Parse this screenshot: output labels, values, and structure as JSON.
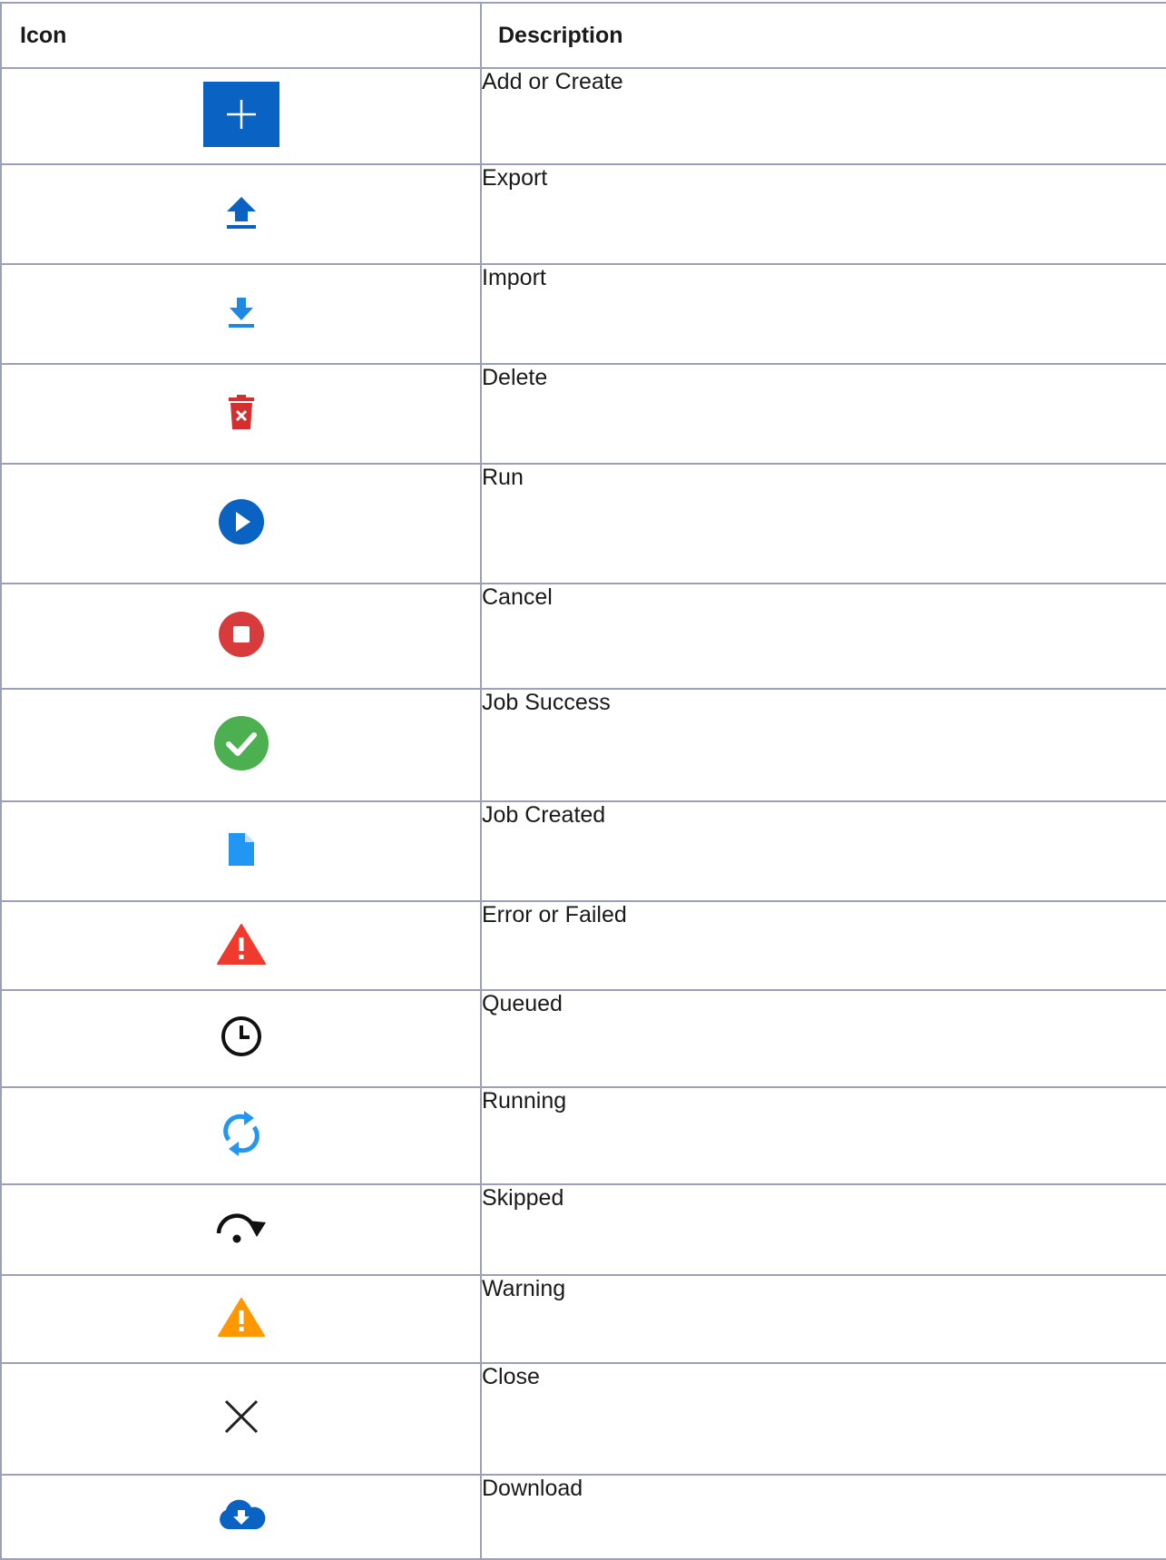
{
  "table": {
    "headers": {
      "icon": "Icon",
      "description": "Description"
    },
    "rows": [
      {
        "icon": "add-icon",
        "description": "Add or Create",
        "color": "#0a62c2"
      },
      {
        "icon": "export-icon",
        "description": "Export",
        "color": "#0a62c2"
      },
      {
        "icon": "import-icon",
        "description": "Import",
        "color": "#1e88e5"
      },
      {
        "icon": "delete-icon",
        "description": "Delete",
        "color": "#d32f2f"
      },
      {
        "icon": "run-icon",
        "description": "Run",
        "color": "#0a62c2"
      },
      {
        "icon": "cancel-icon",
        "description": "Cancel",
        "color": "#d83b3b"
      },
      {
        "icon": "job-success-icon",
        "description": "Job Success",
        "color": "#4caf50"
      },
      {
        "icon": "job-created-icon",
        "description": "Job Created",
        "color": "#2196f3"
      },
      {
        "icon": "error-icon",
        "description": "Error or Failed",
        "color": "#f03a2e"
      },
      {
        "icon": "queued-icon",
        "description": "Queued",
        "color": "#111111"
      },
      {
        "icon": "running-icon",
        "description": "Running",
        "color": "#2196f3"
      },
      {
        "icon": "skipped-icon",
        "description": "Skipped",
        "color": "#111111"
      },
      {
        "icon": "warning-icon",
        "description": "Warning",
        "color": "#ff9800"
      },
      {
        "icon": "close-icon",
        "description": "Close",
        "color": "#222222"
      },
      {
        "icon": "download-icon",
        "description": "Download",
        "color": "#0a62c2"
      }
    ]
  }
}
